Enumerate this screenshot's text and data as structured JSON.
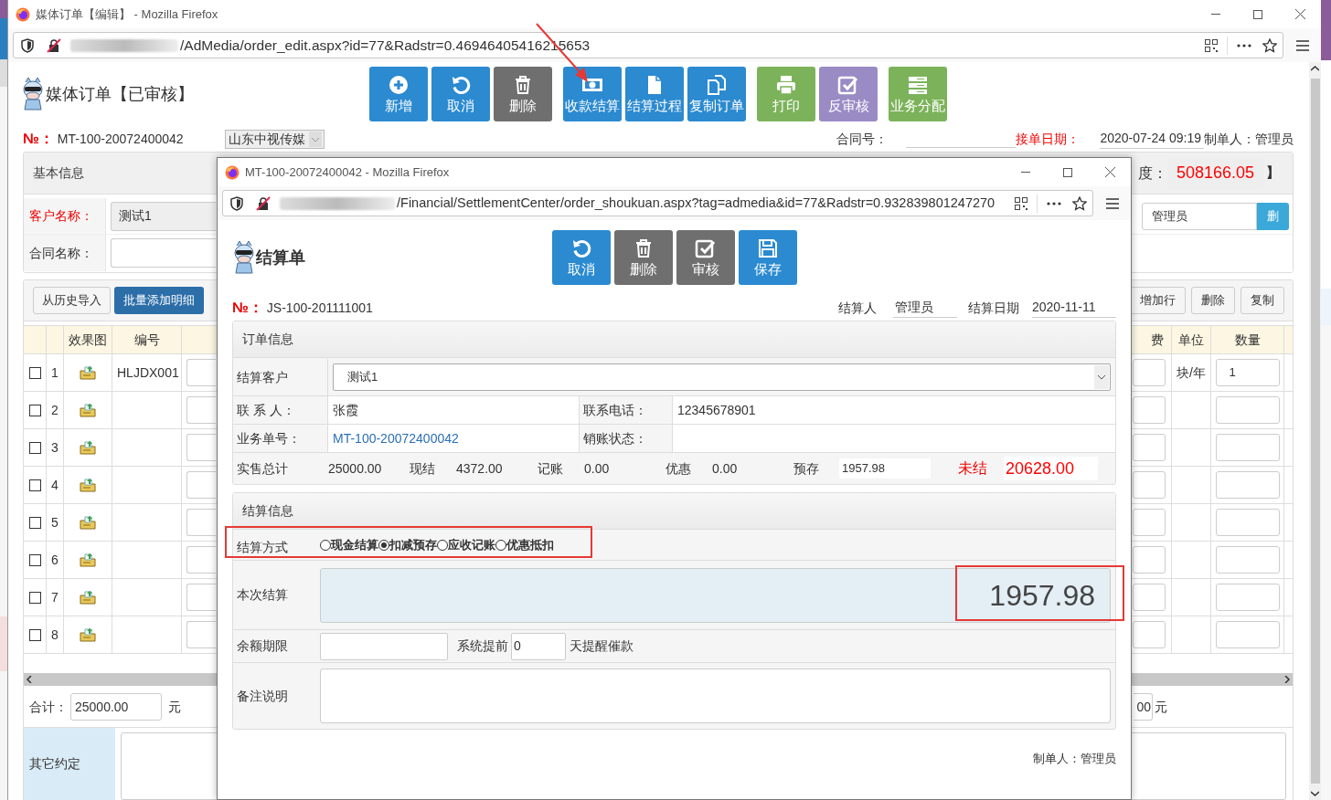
{
  "main_window": {
    "title": "媒体订单【编辑】 - Mozilla Firefox",
    "url": "/AdMedia/order_edit.aspx?id=77&Radstr=0.46946405416215653"
  },
  "order_page": {
    "title": "媒体订单【已审核】",
    "toolbar_groups": [
      [
        {
          "label": "新增",
          "kind": "add",
          "color": "#2b8ad0"
        },
        {
          "label": "取消",
          "kind": "undo",
          "color": "#2b8ad0"
        },
        {
          "label": "删除",
          "kind": "delete",
          "color": "#6f6f6f"
        }
      ],
      [
        {
          "label": "收款结算",
          "kind": "payment",
          "color": "#2b8ad0"
        },
        {
          "label": "结算过程",
          "kind": "process",
          "color": "#2b8ad0"
        },
        {
          "label": "复制订单",
          "kind": "copy",
          "color": "#2b8ad0"
        }
      ],
      [
        {
          "label": "打印",
          "kind": "print",
          "color": "#7cb35a"
        },
        {
          "label": "反审核",
          "kind": "approve",
          "color": "#9a8bc5"
        }
      ],
      [
        {
          "label": "业务分配",
          "kind": "assign",
          "color": "#7cb35a"
        }
      ]
    ],
    "number_label": "№：",
    "number": "MT-100-20072400042",
    "company": "山东中视传媒",
    "contract_no_label": "合同号：",
    "date_label": "接单日期：",
    "date": "2020-07-24 09:19",
    "creator": "制单人：管理员",
    "basic_info": {
      "title": "基本信息",
      "quota_label": "度：",
      "quota": "508166.05",
      "quota_end": "】",
      "customer_label": "客户名称：",
      "customer": "测试1",
      "staff": "管理员",
      "staff_button": "删",
      "contract_name_label": "合同名称："
    },
    "details": {
      "left_buttons": [
        "从历史导入",
        "批量添加明细"
      ],
      "right_buttons": [
        "增加行",
        "删除",
        "复制"
      ],
      "columns": {
        "image": "效果图",
        "code": "编号",
        "fee": "费",
        "unit": "单位",
        "quantity": "数量"
      },
      "rows": [
        {
          "checked": false,
          "number": "1",
          "code": "HLJDX001",
          "unit": "块/年",
          "quantity": "1"
        },
        {
          "checked": false,
          "number": "2"
        },
        {
          "checked": false,
          "number": "3"
        },
        {
          "checked": false,
          "number": "4"
        },
        {
          "checked": false,
          "number": "5"
        },
        {
          "checked": false,
          "number": "6"
        },
        {
          "checked": false,
          "number": "7"
        },
        {
          "checked": false,
          "number": "8"
        }
      ]
    },
    "totals": {
      "label": "合计：",
      "value": "25000.00",
      "unit": "元",
      "right_value": "00",
      "right_unit": "元"
    },
    "other_label": "其它约定"
  },
  "settlement_window": {
    "title": "MT-100-20072400042 - Mozilla Firefox",
    "url": "/Financial/SettlementCenter/order_shoukuan.aspx?tag=admedia&id=77&Radstr=0.932839801247270",
    "page_title": "结算单",
    "toolbar": [
      {
        "label": "取消",
        "kind": "undo",
        "color": "#2b8ad0"
      },
      {
        "label": "删除",
        "kind": "delete",
        "color": "#6f6f6f"
      },
      {
        "label": "审核",
        "kind": "approve",
        "color": "#6f6f6f"
      },
      {
        "label": "保存",
        "kind": "save",
        "color": "#2b8ad0"
      }
    ],
    "number_label": "№：",
    "number": "JS-100-201111001",
    "settler_label": "结算人",
    "settler": "管理员",
    "date_label": "结算日期",
    "date": "2020-11-11",
    "order_info": {
      "title": "订单信息",
      "customer_label": "结算客户",
      "customer": "测试1",
      "contact_label": "联 系 人：",
      "contact": "张霞",
      "phone_label": "联系电话：",
      "phone": "12345678901",
      "order_no_label": "业务单号：",
      "order_no": "MT-100-20072400042",
      "writeoff_label": "销账状态：",
      "stats": [
        {
          "label": "实售总计",
          "value": "25000.00"
        },
        {
          "label": "现结",
          "value": "4372.00"
        },
        {
          "label": "记账",
          "value": "0.00"
        },
        {
          "label": "优惠",
          "value": "0.00"
        }
      ],
      "prepaid_label": "预存",
      "prepaid": "1957.98",
      "unsettled_label": "未结",
      "unsettled": "20628.00"
    },
    "settlement_info": {
      "title": "结算信息",
      "method_label": "结算方式",
      "methods": [
        {
          "label": "现金结算",
          "selected": false
        },
        {
          "label": "扣减预存",
          "selected": true
        },
        {
          "label": "应收记账",
          "selected": false
        },
        {
          "label": "优惠抵扣",
          "selected": false
        }
      ],
      "amount_label": "本次结算",
      "amount": "1957.98",
      "term_label": "余额期限",
      "remind_label": "系统提前",
      "remind_days": "0",
      "remind_suffix": "天提醒催款",
      "note_label": "备注说明"
    },
    "creator": "制单人：管理员"
  }
}
